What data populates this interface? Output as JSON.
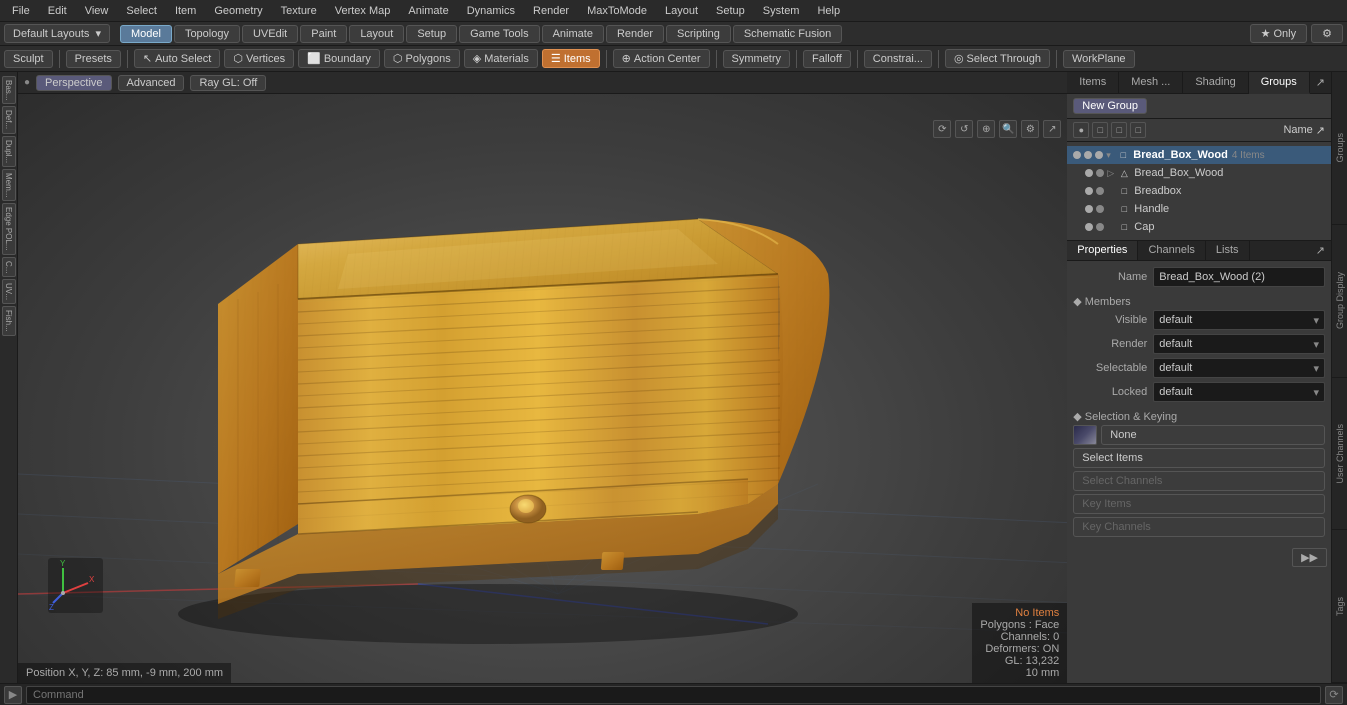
{
  "menu": {
    "items": [
      "File",
      "Edit",
      "View",
      "Select",
      "Item",
      "Geometry",
      "Texture",
      "Vertex Map",
      "Animate",
      "Dynamics",
      "Render",
      "MaxToMode",
      "Layout",
      "Setup",
      "System",
      "Help"
    ]
  },
  "mode_bar": {
    "layout_dropdown": "Default Layouts",
    "tabs": [
      "Model",
      "Topology",
      "UVEdit",
      "Paint",
      "Layout",
      "Setup",
      "Game Tools",
      "Animate",
      "Render",
      "Scripting",
      "Schematic Fusion"
    ],
    "active_tab": "Model",
    "only_btn": "Only",
    "settings_btn": "⚙",
    "plus_btn": "+"
  },
  "tool_bar": {
    "sculpt": "Sculpt",
    "presets": "Presets",
    "auto_select": "Auto Select",
    "vertices": "Vertices",
    "boundary": "Boundary",
    "polygons": "Polygons",
    "materials": "Materials",
    "items": "Items",
    "action_center": "Action Center",
    "symmetry": "Symmetry",
    "falloff": "Falloff",
    "constraint": "Constrai...",
    "select_through": "Select Through",
    "workplane": "WorkPlane"
  },
  "viewport": {
    "perspective": "Perspective",
    "advanced": "Advanced",
    "ray_gl": "Ray GL: Off",
    "icons": [
      "◎",
      "↺",
      "⊕",
      "🔍",
      "⚙",
      "↗"
    ],
    "no_items": "No Items",
    "polygons_face": "Polygons : Face",
    "channels_0": "Channels: 0",
    "deformers_on": "Deformers: ON",
    "gl_count": "GL: 13,232",
    "mm_count": "10 mm",
    "position": "Position X, Y, Z:  85 mm, -9 mm, 200 mm"
  },
  "left_panel": {
    "buttons": [
      "Bas...",
      "Def...",
      "Dupl...",
      "Mem...",
      "Edge POL...",
      "C...",
      "UV...",
      "Fish..."
    ]
  },
  "right_panel": {
    "tabs": [
      "Items",
      "Mesh ...",
      "Shading",
      "Groups"
    ],
    "active_tab": "Groups",
    "new_group_btn": "New Group",
    "name_label": "Name",
    "tree": {
      "root": {
        "icon": "□",
        "name": "Bread_Box_Wood",
        "count": "4 Items",
        "children": [
          {
            "icon": "▷",
            "name": "Bread_Box_Wood",
            "visible": true
          },
          {
            "icon": "□",
            "name": "Breadbox",
            "visible": true
          },
          {
            "icon": "□",
            "name": "Handle",
            "visible": true
          },
          {
            "icon": "□",
            "name": "Cap",
            "visible": true
          }
        ]
      }
    },
    "side_labels": [
      "Groups",
      "Group Display",
      "User Channels",
      "Tags"
    ]
  },
  "properties": {
    "tabs": [
      "Properties",
      "Channels",
      "Lists"
    ],
    "name_label": "Name",
    "name_value": "Bread_Box_Wood (2)",
    "members_section": "Members",
    "visible_label": "Visible",
    "visible_value": "default",
    "render_label": "Render",
    "render_value": "default",
    "selectable_label": "Selectable",
    "selectable_value": "default",
    "locked_label": "Locked",
    "locked_value": "default",
    "selection_keying": "Selection & Keying",
    "none_btn": "None",
    "select_items_btn": "Select Items",
    "select_channels_btn": "Select Channels",
    "key_items_btn": "Key Items",
    "key_channels_btn": "Key Channels"
  },
  "command_bar": {
    "placeholder": "Command",
    "arrow": "▶"
  }
}
